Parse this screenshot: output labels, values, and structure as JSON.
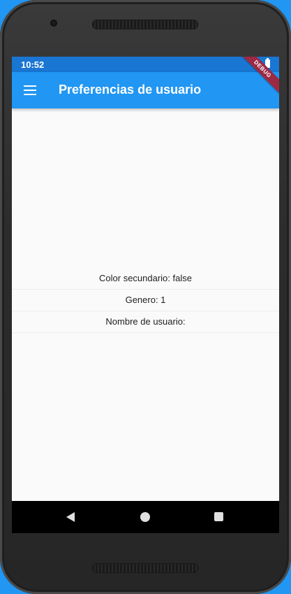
{
  "status_bar": {
    "time": "10:52",
    "battery_icon": "battery-full-icon"
  },
  "debug_banner": "DEBUG",
  "app_bar": {
    "title": "Preferencias de usuario",
    "menu_icon": "menu-icon"
  },
  "preferences": [
    {
      "label": "Color secundario: false"
    },
    {
      "label": "Genero: 1"
    },
    {
      "label": "Nombre de usuario:"
    }
  ],
  "nav_bar": {
    "back_icon": "back-triangle-icon",
    "home_icon": "home-circle-icon",
    "recent_icon": "recent-square-icon"
  },
  "colors": {
    "app_bar": "#2196f3",
    "status_bar": "#1976d2",
    "background": "#fafafa",
    "debug_banner": "#9c2a45"
  }
}
